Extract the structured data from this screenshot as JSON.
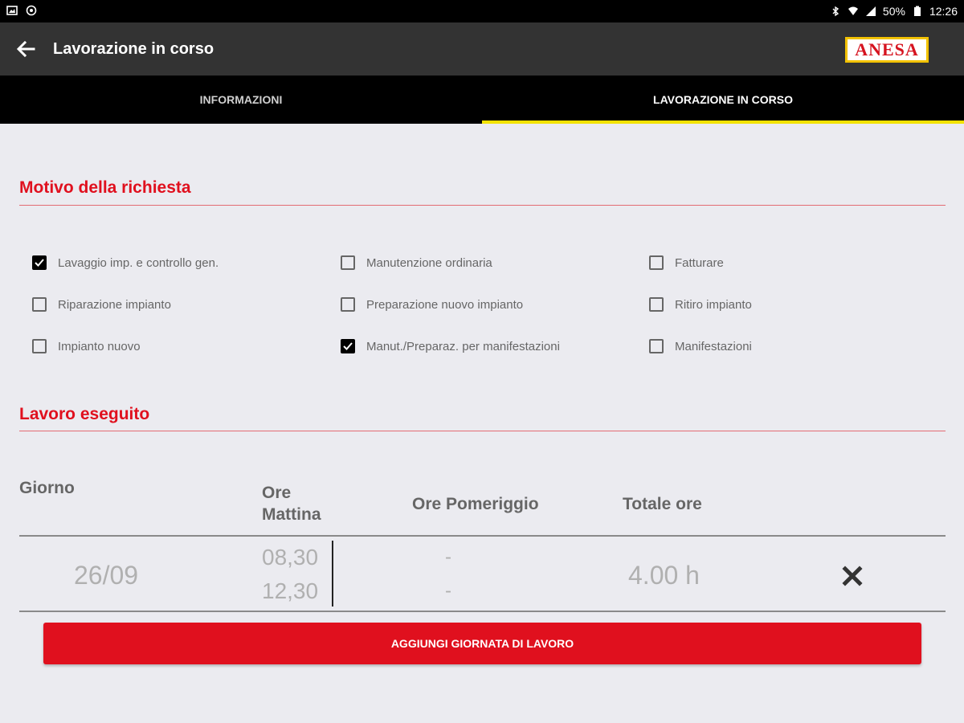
{
  "status_bar": {
    "battery": "50%",
    "time": "12:26"
  },
  "appbar": {
    "title": "Lavorazione in corso",
    "logo_text": "ANESA"
  },
  "tabs": [
    {
      "label": "INFORMAZIONI",
      "active": false
    },
    {
      "label": "LAVORAZIONE IN CORSO",
      "active": true
    }
  ],
  "motivo": {
    "title": "Motivo della richiesta",
    "options": [
      {
        "label": "Lavaggio imp. e controllo gen.",
        "checked": true
      },
      {
        "label": "Manutenzione ordinaria",
        "checked": false
      },
      {
        "label": "Fatturare",
        "checked": false
      },
      {
        "label": "Riparazione impianto",
        "checked": false
      },
      {
        "label": "Preparazione nuovo impianto",
        "checked": false
      },
      {
        "label": "Ritiro impianto",
        "checked": false
      },
      {
        "label": "Impianto nuovo",
        "checked": false
      },
      {
        "label": "Manut./Preparaz. per manifestazioni",
        "checked": true
      },
      {
        "label": "Manifestazioni",
        "checked": false
      }
    ]
  },
  "lavoro": {
    "title": "Lavoro eseguito",
    "headers": {
      "giorno": "Giorno",
      "ore_mattina_1": "Ore",
      "ore_mattina_2": "Mattina",
      "ore_pomeriggio": "Ore Pomeriggio",
      "totale": "Totale ore"
    },
    "rows": [
      {
        "giorno": "26/09",
        "mattina_start": "08,30",
        "mattina_end": "12,30",
        "pomeriggio_start": "-",
        "pomeriggio_end": "-",
        "totale": "4.00 h"
      }
    ],
    "add_button": "AGGIUNGI GIORNATA DI LAVORO"
  },
  "colors": {
    "accent": "#e0101e",
    "tab_indicator": "#f2e200",
    "appbar": "#333333"
  }
}
